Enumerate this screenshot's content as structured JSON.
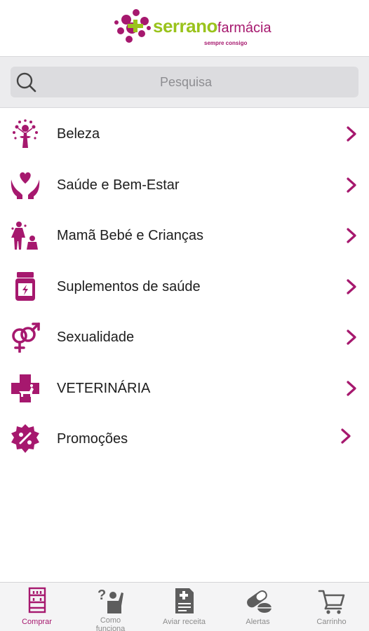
{
  "brand": {
    "name_part1": "serrano",
    "name_part2": "farmácia",
    "tagline": "sempre consigo",
    "primary_color": "#a6186e",
    "accent_color": "#9ac31c"
  },
  "search": {
    "placeholder": "Pesquisa",
    "icon": "search-icon"
  },
  "menu": {
    "items": [
      {
        "label": "Beleza",
        "icon": "beauty-tree-icon"
      },
      {
        "label": "Saúde e Bem-Estar",
        "icon": "heart-hands-icon"
      },
      {
        "label": "Mamã Bebé e Crianças",
        "icon": "mother-baby-icon"
      },
      {
        "label": "Suplementos de saúde",
        "icon": "supplement-jar-icon"
      },
      {
        "label": "Sexualidade",
        "icon": "gender-symbols-icon"
      },
      {
        "label": "VETERINÁRIA",
        "icon": "vet-cross-icon"
      },
      {
        "label": "Promoções",
        "icon": "discount-badge-icon"
      }
    ]
  },
  "tabbar": {
    "tabs": [
      {
        "label": "Comprar",
        "icon": "shop-shelf-icon",
        "active": true
      },
      {
        "label": "Como funciona",
        "icon": "help-person-icon",
        "active": false
      },
      {
        "label": "Aviar receita",
        "icon": "prescription-icon",
        "active": false
      },
      {
        "label": "Alertas",
        "icon": "pills-icon",
        "active": false
      },
      {
        "label": "Carrinho",
        "icon": "cart-icon",
        "active": false
      }
    ]
  }
}
